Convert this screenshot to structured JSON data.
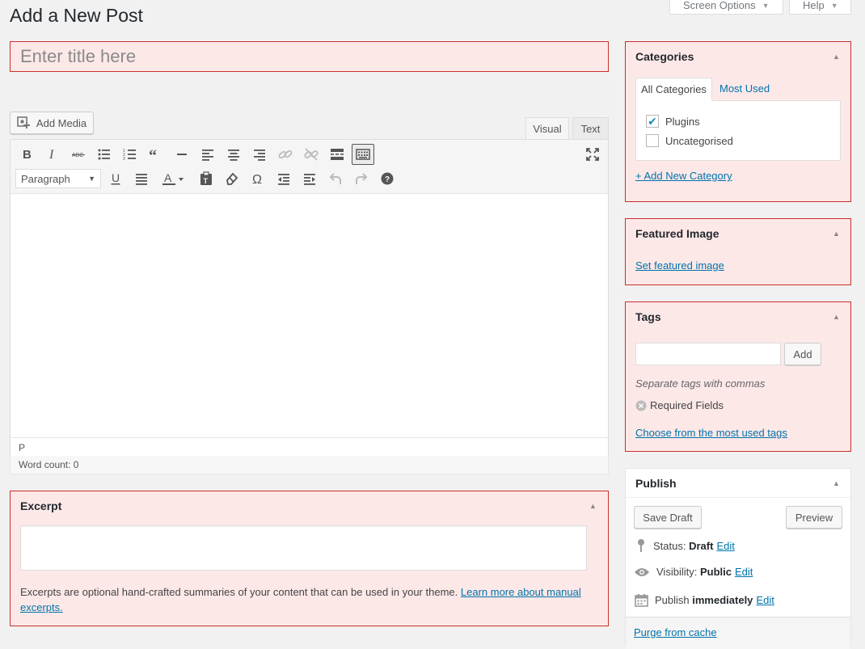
{
  "header": {
    "title": "Add a New Post",
    "screen_options": "Screen Options",
    "help": "Help"
  },
  "title_field": {
    "placeholder": "Enter title here",
    "value": ""
  },
  "editor": {
    "add_media": "Add Media",
    "tabs": {
      "visual": "Visual",
      "text": "Text",
      "active": "visual"
    },
    "format_select": "Paragraph",
    "path": "P",
    "word_count": "Word count: 0",
    "toolbar_row1": [
      "bold-icon",
      "italic-icon",
      "strikethrough-icon",
      "bulleted-list-icon",
      "numbered-list-icon",
      "blockquote-icon",
      "horizontal-line-icon",
      "align-left-icon",
      "align-center-icon",
      "align-right-icon",
      "insert-link-icon",
      "remove-link-icon",
      "read-more-icon",
      "toolbar-toggle-icon"
    ],
    "toolbar_row2": [
      "underline-icon",
      "justify-icon",
      "text-color-icon",
      "paste-as-text-icon",
      "clear-formatting-icon",
      "special-character-icon",
      "decrease-indent-icon",
      "increase-indent-icon",
      "undo-icon",
      "redo-icon",
      "keyboard-shortcuts-icon"
    ]
  },
  "excerpt": {
    "title": "Excerpt",
    "help_text": "Excerpts are optional hand-crafted summaries of your content that can be used in your theme.",
    "help_link": "Learn more about manual excerpts."
  },
  "categories": {
    "title": "Categories",
    "tabs": [
      "All Categories",
      "Most Used"
    ],
    "items": [
      {
        "label": "Plugins",
        "checked": true
      },
      {
        "label": "Uncategorised",
        "checked": false
      }
    ],
    "add_new": "+ Add New Category"
  },
  "featured_image": {
    "title": "Featured Image",
    "link": "Set featured image"
  },
  "tags": {
    "title": "Tags",
    "add_button": "Add",
    "hint": "Separate tags with commas",
    "required": "Required Fields",
    "choose_link": "Choose from the most used tags"
  },
  "publish": {
    "title": "Publish",
    "save_draft": "Save Draft",
    "preview": "Preview",
    "status_label": "Status:",
    "status_value": "Draft",
    "visibility_label": "Visibility:",
    "visibility_value": "Public",
    "publish_label": "Publish",
    "publish_value": "immediately",
    "edit": "Edit",
    "purge": "Purge from cache"
  },
  "colors": {
    "error_border": "#c9302c",
    "error_bg": "#fde8e8",
    "link": "#0073aa"
  }
}
